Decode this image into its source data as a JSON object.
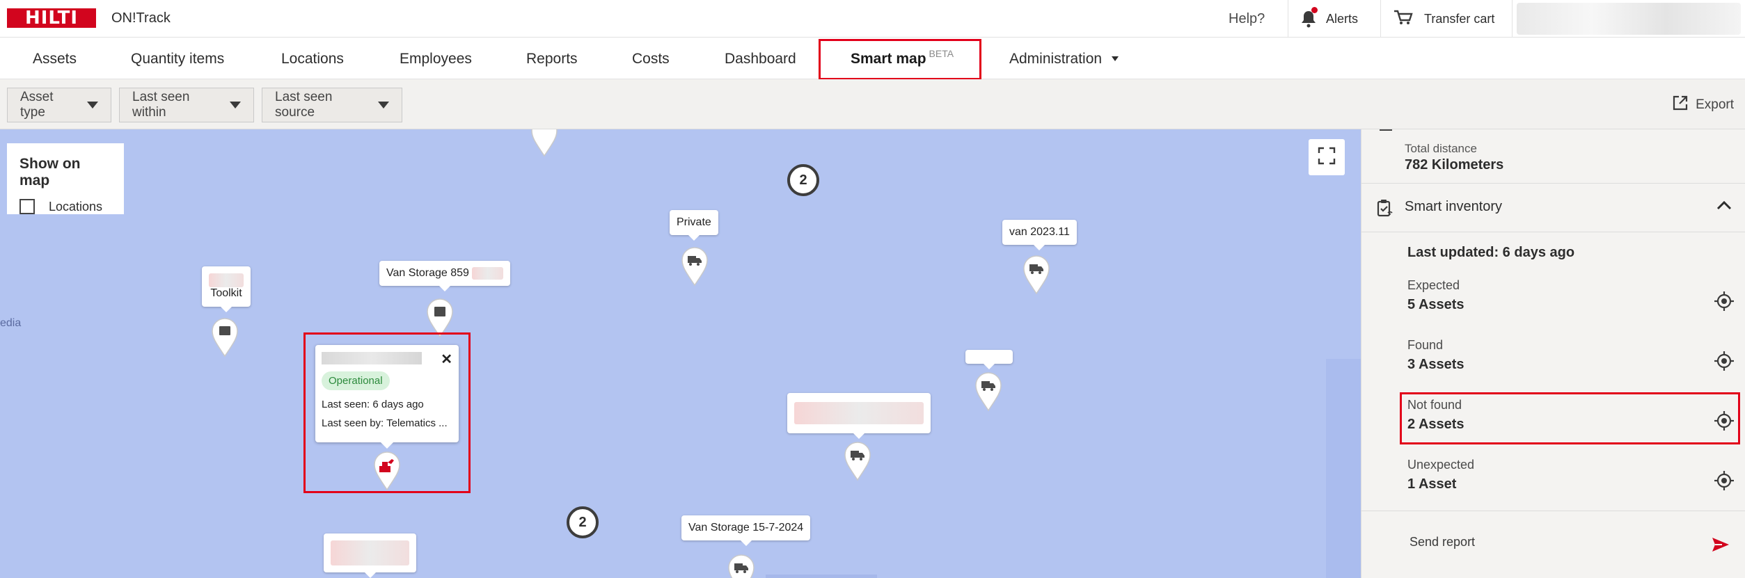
{
  "header": {
    "logo": "HILTI",
    "app_name": "ON!Track",
    "help": "Help?",
    "alerts": "Alerts",
    "transfer_cart": "Transfer cart"
  },
  "nav": {
    "items": [
      {
        "label": "Assets"
      },
      {
        "label": "Quantity items"
      },
      {
        "label": "Locations"
      },
      {
        "label": "Employees"
      },
      {
        "label": "Reports"
      },
      {
        "label": "Costs"
      },
      {
        "label": "Dashboard"
      },
      {
        "label": "Smart map",
        "badge": "BETA",
        "active": true
      },
      {
        "label": "Administration"
      }
    ]
  },
  "filters": {
    "asset_type": "Asset type",
    "last_seen_within": "Last seen within",
    "last_seen_source": "Last seen source",
    "export": "Export"
  },
  "map": {
    "show_on_map": "Show on map",
    "locations_checkbox": "Locations",
    "edge_text": "edia",
    "clusters": [
      "2",
      "2"
    ],
    "labels": {
      "toolkit": "Toolkit",
      "van_storage_859": "Van Storage 859",
      "private": "Private",
      "van_2023": "van 2023.11",
      "van_storage_2024": "Van Storage 15-7-2024"
    },
    "popup": {
      "status": "Operational",
      "last_seen": "Last seen: 6 days ago",
      "last_seen_by": "Last seen by: Telematics ..."
    }
  },
  "panel": {
    "total_distance_label": "Total distance",
    "total_distance_value": "782 Kilometers",
    "smart_inventory_title": "Smart inventory",
    "last_updated": "Last updated: 6 days ago",
    "rows": [
      {
        "label": "Expected",
        "value": "5 Assets"
      },
      {
        "label": "Found",
        "value": "3 Assets"
      },
      {
        "label": "Not found",
        "value": "2 Assets"
      },
      {
        "label": "Unexpected",
        "value": "1 Asset"
      }
    ],
    "send_report": "Send report"
  },
  "colors": {
    "brand": "#d2051e",
    "map_water": "#b3c4f1",
    "highlight": "#e2001a",
    "operational_badge": "#d8f2dc"
  }
}
